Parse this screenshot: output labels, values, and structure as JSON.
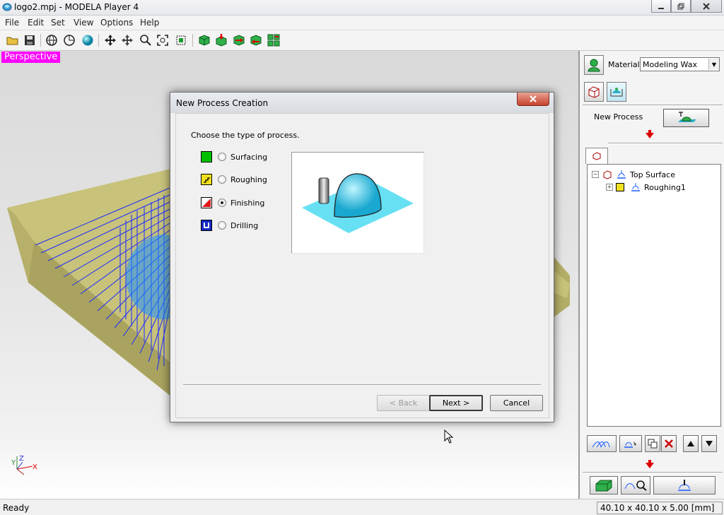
{
  "window": {
    "title": "logo2.mpj - MODELA Player 4",
    "minimize_icon": "minimize-icon",
    "maximize_icon": "restore-icon",
    "close_icon": "close-icon"
  },
  "menu": {
    "items": [
      "File",
      "Edit",
      "Set",
      "View",
      "Options",
      "Help"
    ]
  },
  "toolbar": {
    "icons": [
      "open-folder-icon",
      "save-icon",
      "globe-view-icon",
      "sphere-outline-icon",
      "shaded-sphere-icon",
      "pan-icon",
      "move-icon",
      "zoom-icon",
      "fit-icon",
      "zoom-window-icon",
      "cube-icon",
      "cube-down-icon",
      "cube-right-icon",
      "cube-left-icon",
      "cube-grid-icon"
    ]
  },
  "viewport": {
    "view_label": "Perspective",
    "axes": {
      "x": "X",
      "y": "Y",
      "z": "Z"
    }
  },
  "dialog": {
    "title": "New Process Creation",
    "prompt": "Choose the type of process.",
    "options": [
      {
        "label": "Surfacing",
        "color": "#00c000",
        "selected": false
      },
      {
        "label": "Roughing",
        "color": "#e8d800",
        "selected": false
      },
      {
        "label": "Finishing",
        "color": "#e01818",
        "selected": true
      },
      {
        "label": "Drilling",
        "color": "#1428c8",
        "selected": false
      }
    ],
    "buttons": {
      "back": "< Back",
      "next": "Next >",
      "cancel": "Cancel"
    }
  },
  "panel": {
    "material_label": "Material",
    "material_value": "Modeling Wax",
    "new_process_label": "New Process",
    "tree": {
      "root": "Top Surface",
      "child": "Roughing1"
    }
  },
  "status": {
    "text": "Ready",
    "dimensions": "40.10 x 40.10 x 5.00 [mm]"
  },
  "colors": {
    "accent_magenta": "#ff00ff",
    "model_tan": "#c8c27a",
    "toolpath_blue": "#1a2bff",
    "preview_cyan": "#68e0f4"
  }
}
